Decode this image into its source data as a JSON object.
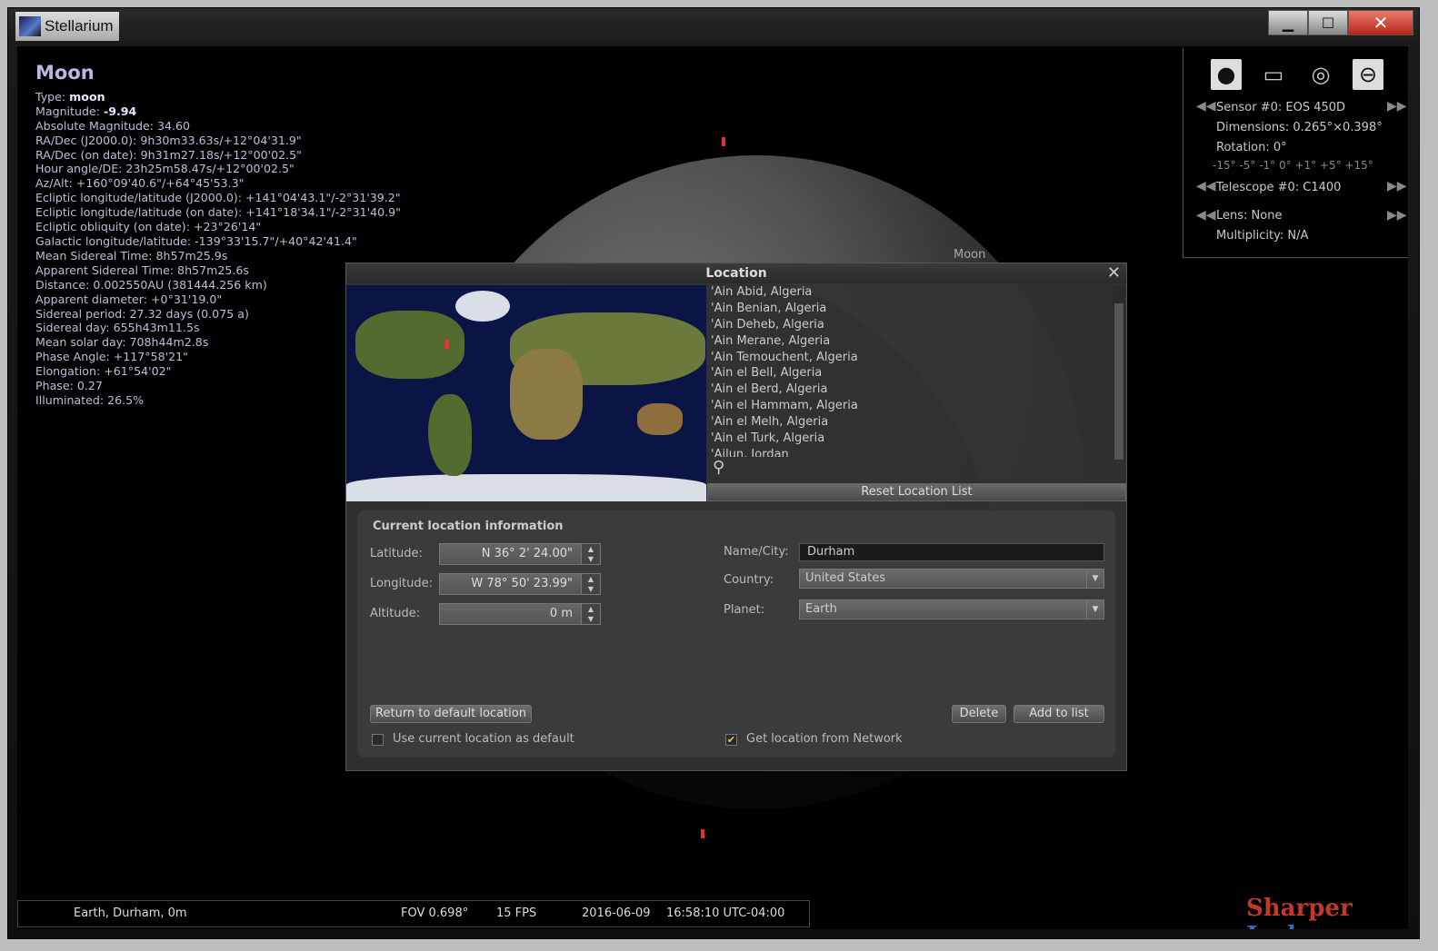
{
  "window": {
    "title": "Stellarium"
  },
  "object_info": {
    "name": "Moon",
    "type_label": "Type: ",
    "type_value": "moon",
    "magnitude_label": "Magnitude: ",
    "magnitude_value": "-9.94",
    "lines": [
      "Absolute Magnitude: 34.60",
      "RA/Dec (J2000.0): 9h30m33.63s/+12°04'31.9\"",
      "RA/Dec (on date): 9h31m27.18s/+12°00'02.5\"",
      "Hour angle/DE: 23h25m58.47s/+12°00'02.5\"",
      "Az/Alt: +160°09'40.6\"/+64°45'53.3\"",
      "Ecliptic longitude/latitude (J2000.0): +141°04'43.1\"/-2°31'39.2\"",
      "Ecliptic longitude/latitude (on date): +141°18'34.1\"/-2°31'40.9\"",
      "Ecliptic obliquity (on date): +23°26'14\"",
      "Galactic longitude/latitude: -139°33'15.7\"/+40°42'41.4\"",
      "Mean Sidereal Time: 8h57m25.9s",
      "Apparent Sidereal Time: 8h57m25.6s",
      "Distance: 0.002550AU (381444.256 km)",
      "Apparent diameter: +0°31'19.0\"",
      "Sidereal period: 27.32 days (0.075 a)",
      "Sidereal day: 655h43m11.5s",
      "Mean solar day: 708h44m2.8s",
      "Phase Angle: +117°58'21\"",
      "Elongation: +61°54'02\"",
      "Phase: 0.27",
      "Illuminated: 26.5%"
    ]
  },
  "sky_label": "Moon",
  "oculars": {
    "sensor": "Sensor #0: EOS 450D",
    "dimensions": "Dimensions: 0.265°×0.398°",
    "rotation": "Rotation: 0°",
    "rotation_steps": "-15° -5° -1° 0° +1° +5° +15°",
    "telescope": "Telescope #0: C1400",
    "lens": "Lens: None",
    "multiplicity": "Multiplicity: N/A"
  },
  "location_dialog": {
    "title": "Location",
    "locations": [
      "'Ain Abid, Algeria",
      "'Ain Benian, Algeria",
      "'Ain Deheb, Algeria",
      "'Ain Merane, Algeria",
      "'Ain Temouchent, Algeria",
      "'Ain el Bell, Algeria",
      "'Ain el Berd, Algeria",
      "'Ain el Hammam, Algeria",
      "'Ain el Melh, Algeria",
      "'Ain el Turk, Algeria",
      "'Ajlun, Jordan"
    ],
    "reset_button": "Reset Location List",
    "section_title": "Current location information",
    "latitude_label": "Latitude:",
    "latitude_value": "N 36° 2' 24.00\"",
    "longitude_label": "Longitude:",
    "longitude_value": "W 78° 50' 23.99\"",
    "altitude_label": "Altitude:",
    "altitude_value": "0 m",
    "name_label": "Name/City:",
    "name_value": "Durham",
    "country_label": "Country:",
    "country_value": "United States",
    "planet_label": "Planet:",
    "planet_value": "Earth",
    "return_button": "Return to default location",
    "delete_button": "Delete",
    "add_button": "Add to list",
    "use_default_label": "Use current location as default",
    "use_default_checked": false,
    "network_label": "Get location from Network",
    "network_checked": true
  },
  "status": {
    "location": "Earth, Durham, 0m",
    "fov": "FOV 0.698°",
    "fps": "15 FPS",
    "date": "2016-06-09",
    "time": "16:58:10 UTC-04:00"
  },
  "watermark": {
    "part1": "Sharper",
    "part2": "Jacks",
    "color1": "#c0392b",
    "color2": "#2e6bd1"
  }
}
